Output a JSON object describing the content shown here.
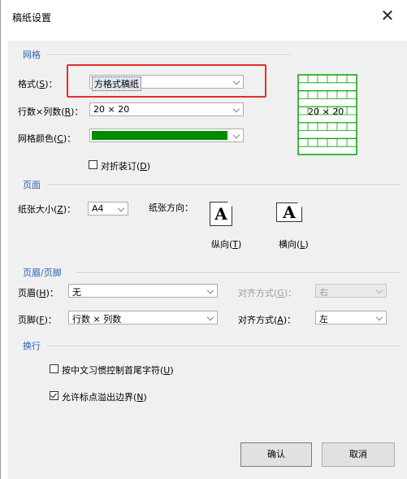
{
  "dialog": {
    "title": "稿纸设置",
    "close_symbol": "✕"
  },
  "grid_section": {
    "title": "网格",
    "format": {
      "label": "格式(",
      "key": "S",
      "suffix": ")：",
      "value": "方格式稿纸"
    },
    "rows_cols": {
      "label": "行数×列数(",
      "key": "R",
      "suffix": ")：",
      "value": "20 × 20"
    },
    "color": {
      "label": "网格颜色(",
      "key": "C",
      "suffix": ")：",
      "swatch": "#008a00"
    },
    "fold": {
      "label": "对折装订(",
      "key": "D",
      "suffix": ")",
      "checked": false
    },
    "preview": {
      "text": "20 × 20",
      "line_color": "#00a000",
      "rows": 10,
      "cols": 6
    }
  },
  "page_section": {
    "title": "页面",
    "paper_size": {
      "label": "纸张大小(",
      "key": "Z",
      "suffix": ")：",
      "value": "A4"
    },
    "orientation_label": "纸张方向：",
    "portrait": {
      "icon": "A",
      "label": "纵向(",
      "key": "T",
      "suffix": ")"
    },
    "landscape": {
      "icon": "A",
      "label": "横向(",
      "key": "L",
      "suffix": ")"
    }
  },
  "header_footer_section": {
    "title": "页眉/页脚",
    "header": {
      "label": "页眉(",
      "key": "H",
      "suffix": ")：",
      "value": "无",
      "align_label": "对齐方式(",
      "align_key": "G",
      "align_suffix": ")：",
      "align_value": "右"
    },
    "footer": {
      "label": "页脚(",
      "key": "F",
      "suffix": ")：",
      "value": "行数 × 列数",
      "align_label": "对齐方式(",
      "align_key": "A",
      "align_suffix": ")：",
      "align_value": "左"
    }
  },
  "wrap_section": {
    "title": "换行",
    "option1": {
      "label": "按中文习惯控制首尾字符(",
      "key": "U",
      "suffix": ")",
      "checked": false
    },
    "option2": {
      "label": "允许标点溢出边界(",
      "key": "N",
      "suffix": ")",
      "checked": true
    }
  },
  "buttons": {
    "ok": "确认",
    "cancel": "取消"
  },
  "colors": {
    "section_title": "#2b63b8",
    "highlight": "#e0302c",
    "accent_green": "#008a00"
  }
}
